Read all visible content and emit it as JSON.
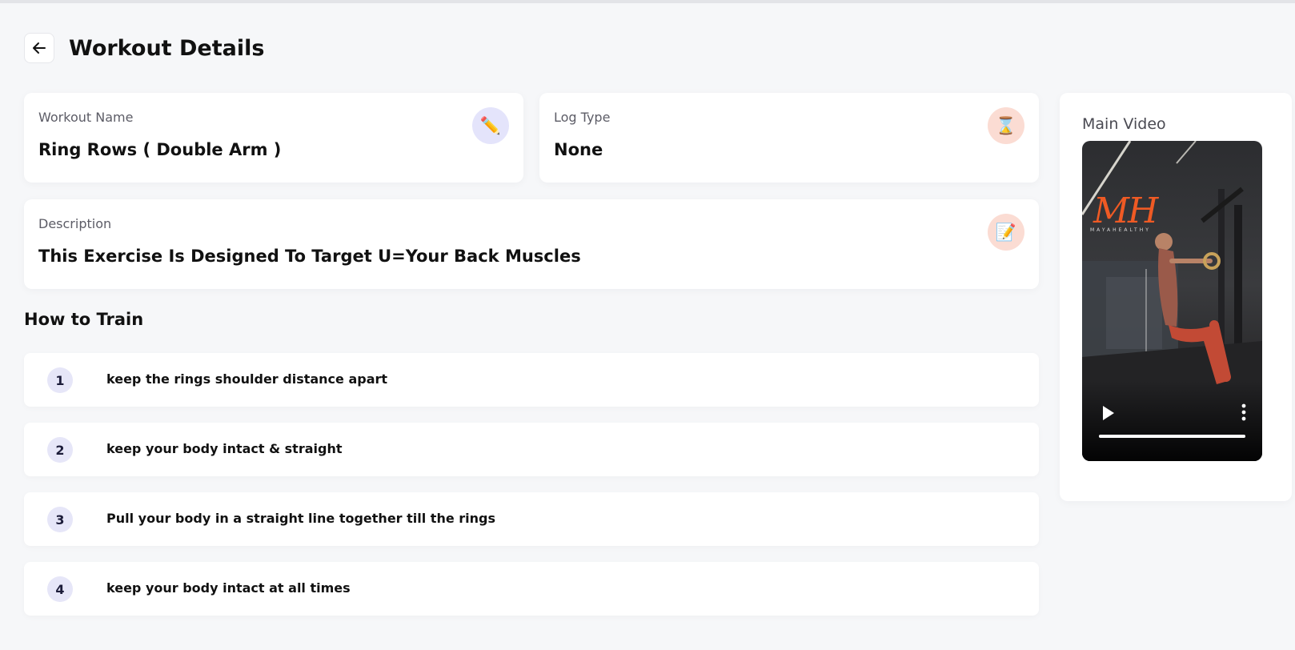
{
  "header": {
    "title": "Workout Details",
    "back_icon": "arrow-left-icon"
  },
  "workout_name": {
    "label": "Workout Name",
    "value": "Ring Rows ( Double Arm )",
    "icon": "pencil-icon"
  },
  "log_type": {
    "label": "Log Type",
    "value": "None",
    "icon": "hourglass-icon"
  },
  "description": {
    "label": "Description",
    "value": "This Exercise Is Designed To Target U=Your Back Muscles",
    "icon": "memo-icon"
  },
  "how_to_train": {
    "title": "How to Train",
    "steps": [
      {
        "number": "1",
        "text": "keep the rings shoulder distance apart"
      },
      {
        "number": "2",
        "text": "keep your body intact & straight"
      },
      {
        "number": "3",
        "text": "Pull your body in a straight line together till the rings"
      },
      {
        "number": "4",
        "text": "keep your body intact at all times"
      }
    ]
  },
  "main_video": {
    "label": "Main Video",
    "logo_text": "MH",
    "logo_subtext": "MAYAHEALTHY",
    "progress": 1.0,
    "play_icon": "play-icon",
    "more_icon": "more-vertical-icon"
  },
  "colors": {
    "background": "#f6f7f9",
    "card": "#ffffff",
    "lavender_accent": "#e4e4fb",
    "peach_accent": "#fbdcd3",
    "logo_orange": "#ef5a24"
  }
}
